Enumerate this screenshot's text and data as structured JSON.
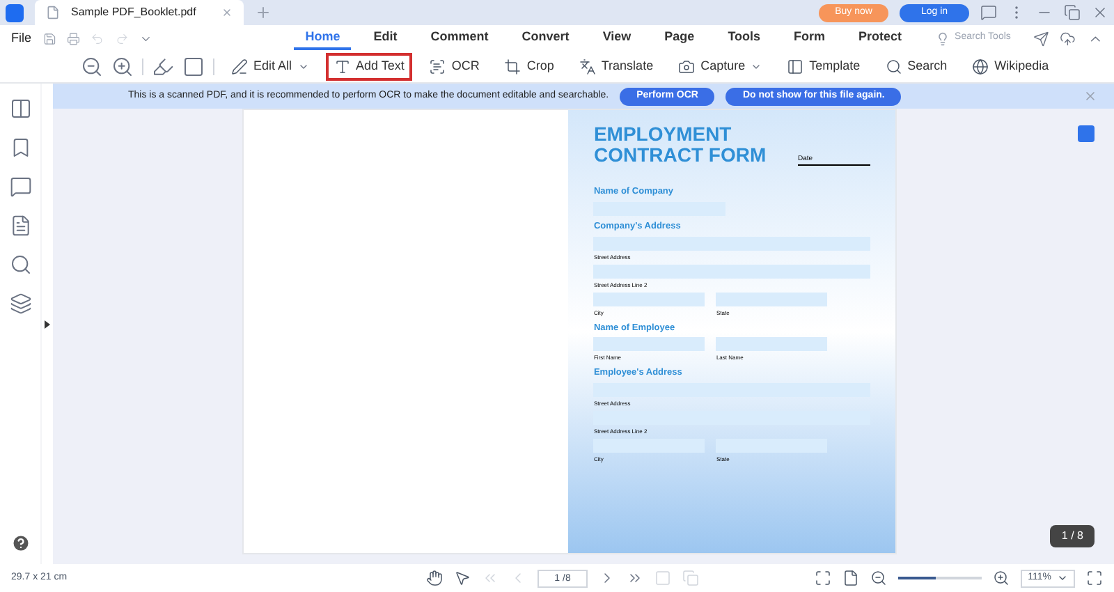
{
  "title_bar": {
    "tab_title": "Sample PDF_Booklet.pdf",
    "buy_button": "Buy now",
    "login_button": "Log in"
  },
  "menu": {
    "file": "File",
    "tabs": [
      {
        "label": "Home",
        "selected": true
      },
      {
        "label": "Edit",
        "selected": false
      },
      {
        "label": "Comment",
        "selected": false
      },
      {
        "label": "Convert",
        "selected": false
      },
      {
        "label": "View",
        "selected": false
      },
      {
        "label": "Page",
        "selected": false
      },
      {
        "label": "Tools",
        "selected": false
      },
      {
        "label": "Form",
        "selected": false
      },
      {
        "label": "Protect",
        "selected": false
      }
    ],
    "search": {
      "placeholder": "Search Tools"
    }
  },
  "toolbar": [
    {
      "label": "Edit All",
      "caret": true,
      "highlighted": false
    },
    {
      "label": "Add Text",
      "caret": false,
      "highlighted": true
    },
    {
      "label": "OCR",
      "caret": false,
      "highlighted": false
    },
    {
      "label": "Crop",
      "caret": false,
      "highlighted": false
    },
    {
      "label": "Translate",
      "caret": false,
      "highlighted": false
    },
    {
      "label": "Capture",
      "caret": true,
      "highlighted": false
    },
    {
      "label": "Template",
      "caret": false,
      "highlighted": false
    },
    {
      "label": "Search",
      "caret": false,
      "highlighted": false
    },
    {
      "label": "Wikipedia",
      "caret": false,
      "highlighted": false
    }
  ],
  "banner": {
    "message": "This is a scanned PDF, and it is recommended to perform OCR to make the document editable and searchable.",
    "buttons": [
      "Perform OCR",
      "Do not show for this file again."
    ]
  },
  "document": {
    "title": [
      "EMPLOYMENT",
      "CONTRACT FORM"
    ],
    "date_label": "Date",
    "sections": [
      {
        "heading": "Name of Company",
        "rows": [
          [
            {}
          ]
        ]
      },
      {
        "heading": "Company's Address",
        "rows": [
          [
            {
              "label": "Street Address"
            }
          ],
          [
            {
              "label": "Street Address Line 2"
            }
          ],
          [
            {
              "label": "City"
            },
            {
              "label": "State"
            }
          ]
        ]
      },
      {
        "heading": "Name of Employee",
        "rows": [
          [
            {
              "label": "First Name"
            },
            {
              "label": "Last Name"
            }
          ]
        ]
      },
      {
        "heading": "Employee's Address",
        "rows": [
          [
            {
              "label": "Street Address"
            }
          ],
          [
            {
              "label": "Street Address Line 2"
            }
          ],
          [
            {
              "label": "City"
            },
            {
              "label": "State"
            }
          ]
        ]
      }
    ]
  },
  "page_badge": "1 / 8",
  "status_bar": {
    "dimensions": "29.7 x 21 cm",
    "page_field": "1 /8",
    "zoom": {
      "level": 0.45
    },
    "zoom_value": "111%"
  }
}
